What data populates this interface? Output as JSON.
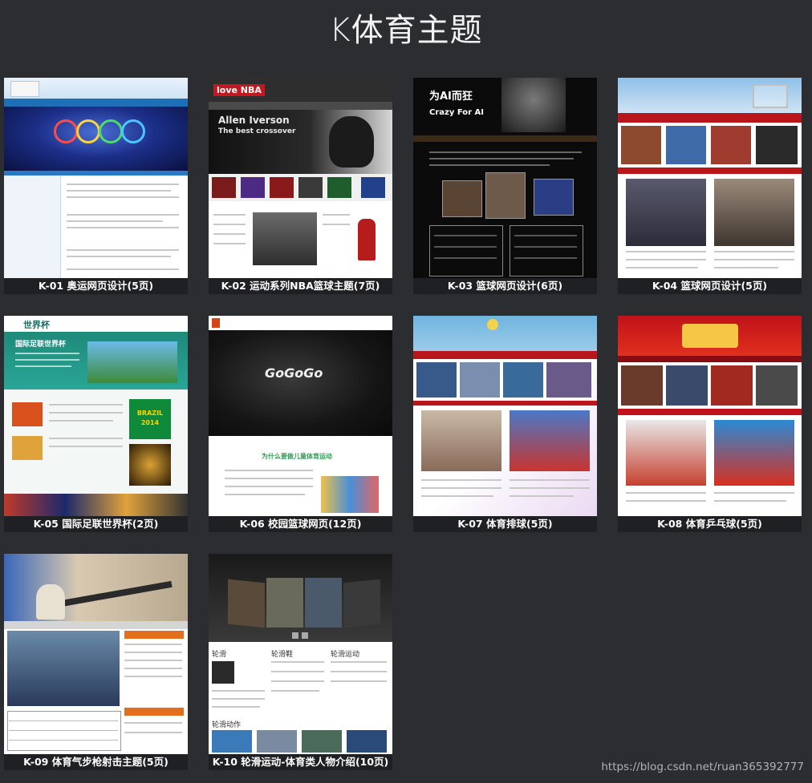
{
  "header": {
    "title": "K体育主题"
  },
  "cards": [
    {
      "caption": "K-01 奥运网页设计(5页)"
    },
    {
      "caption": "K-02 运动系列NBA篮球主题(7页)",
      "thumb_logo": "love NBA",
      "thumb_banner_1": "Allen Iverson",
      "thumb_banner_2": "The best crossover"
    },
    {
      "caption": "K-03 篮球网页设计(6页)",
      "thumb_title": "为AI而狂",
      "thumb_subtitle": "Crazy For AI"
    },
    {
      "caption": "K-04 篮球网页设计(5页)"
    },
    {
      "caption": "K-05 国际足联世界杯(2页)",
      "thumb_logo": "世界杯",
      "thumb_heading": "国际足联世界杯",
      "thumb_badge_1": "BRAZIL",
      "thumb_badge_2": "2014"
    },
    {
      "caption": "K-06 校园篮球网页(12页)",
      "thumb_slogan": "GoGoGo",
      "thumb_heading": "为什么要做儿童体育运动"
    },
    {
      "caption": "K-07 体育排球(5页)"
    },
    {
      "caption": "K-08 体育乒乓球(5页)"
    },
    {
      "caption": "K-09 体育气步枪射击主题(5页)"
    },
    {
      "caption": "K-10 轮滑运动-体育类人物介绍(10页)",
      "thumb_label_1": "轮滑",
      "thumb_label_2": "轮滑鞋",
      "thumb_label_3": "轮滑运动",
      "thumb_label_4": "轮滑动作"
    }
  ],
  "footer": {
    "watermark": "https://blog.csdn.net/ruan365392777"
  },
  "colors": {
    "background": "#2b2d31",
    "caption_bg": "#1f2023",
    "text": "#ffffff"
  }
}
